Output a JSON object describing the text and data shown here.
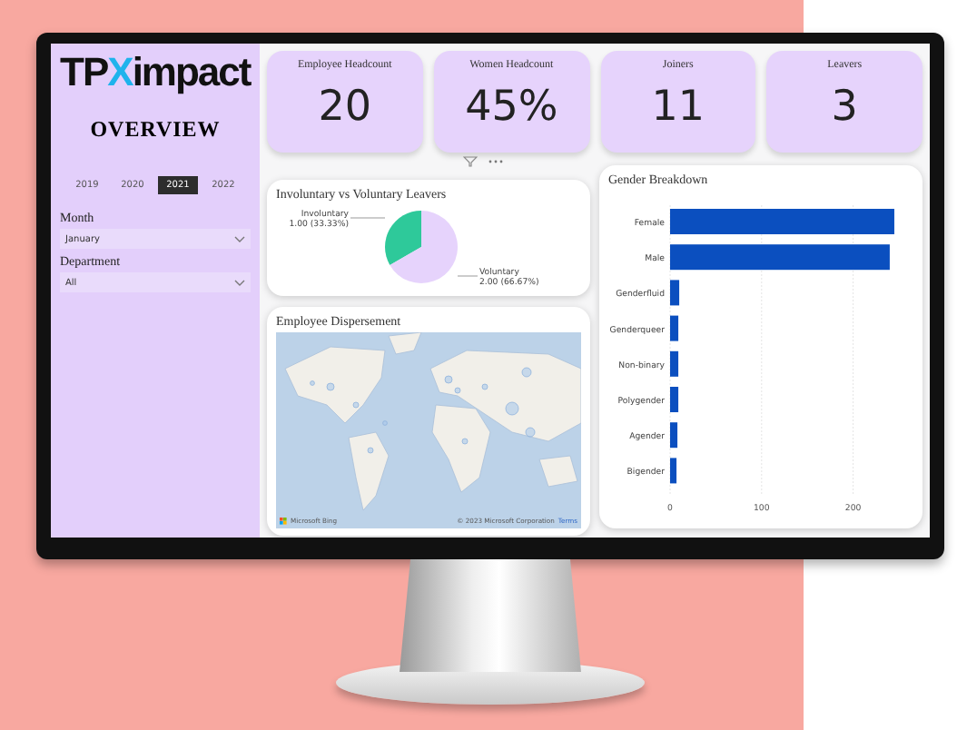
{
  "sidebar": {
    "logo": [
      {
        "text": "TP",
        "color": "#111111"
      },
      {
        "text": "X",
        "color": "#1fb3ec"
      },
      {
        "text": "impact",
        "color": "#111111"
      }
    ],
    "title": "OVERVIEW",
    "years": [
      {
        "label": "2019",
        "selected": false
      },
      {
        "label": "2020",
        "selected": false
      },
      {
        "label": "2021",
        "selected": true
      },
      {
        "label": "2022",
        "selected": false
      }
    ],
    "filters": [
      {
        "label": "Month",
        "value": "January"
      },
      {
        "label": "Department",
        "value": "All"
      }
    ]
  },
  "kpis": [
    {
      "title": "Employee Headcount",
      "value": "20"
    },
    {
      "title": "Women Headcount",
      "value": "45%"
    },
    {
      "title": "Joiners",
      "value": "11"
    },
    {
      "title": "Leavers",
      "value": "3"
    }
  ],
  "leavers_chart": {
    "title": "Involuntary vs Voluntary Leavers",
    "chart_data": {
      "type": "pie",
      "categories": [
        "Involuntary",
        "Voluntary"
      ],
      "values": [
        1,
        2
      ],
      "colors": [
        "#2ec99a",
        "#e6d3fc"
      ],
      "value_labels": [
        "1.00 (33.33%)",
        "2.00 (66.67%)"
      ]
    }
  },
  "map": {
    "title": "Employee Dispersement",
    "attribution": "Microsoft Bing",
    "copyright": "© 2023 Microsoft Corporation",
    "terms": "Terms"
  },
  "gender_chart": {
    "title": "Gender Breakdown",
    "chart_data": {
      "type": "bar",
      "orientation": "horizontal",
      "categories": [
        "Female",
        "Male",
        "Genderfluid",
        "Genderqueer",
        "Non-binary",
        "Polygender",
        "Agender",
        "Bigender"
      ],
      "values": [
        245,
        240,
        10,
        9,
        9,
        9,
        8,
        7
      ],
      "color": "#0b4fbf",
      "xlim": [
        0,
        250
      ],
      "xticks": [
        0,
        100,
        200
      ]
    }
  }
}
